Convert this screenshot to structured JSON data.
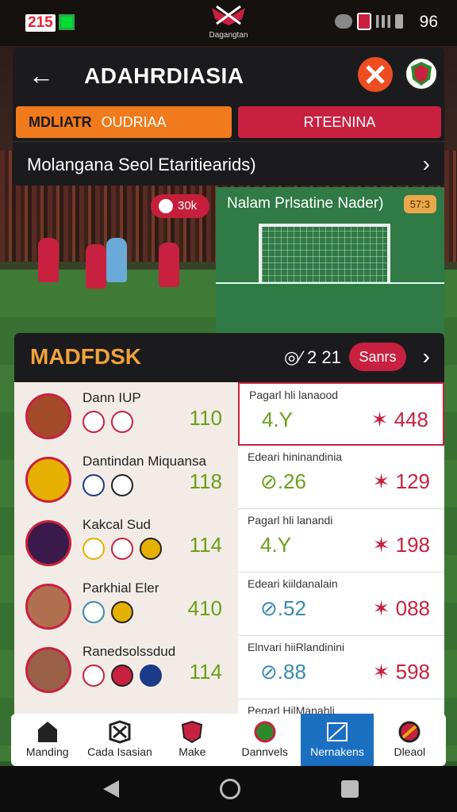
{
  "status_bar": {
    "left_badge": "215",
    "right_value": "96",
    "logo_text": "Dagangtan"
  },
  "header": {
    "title": "ADAHRDIASIA",
    "back_icon": "arrow-left-icon"
  },
  "tabs": [
    {
      "bold": "MDLIATR",
      "rest": "OUDRIAA"
    },
    {
      "label": "RTEENINA"
    }
  ],
  "subrow": {
    "text": "Molangana Seol Etaritiearids)"
  },
  "hero": {
    "pill": "30k",
    "goal_label": "Nalam Prlsatine Nader)",
    "goal_badge": "57:3"
  },
  "card": {
    "title": "MADFDSK",
    "count": "◎⁄ 2 21",
    "button": "Sanrs",
    "left_rows": [
      {
        "name": "Dann IUP",
        "value": "110"
      },
      {
        "name": "Dantindan Miquansa",
        "value": "118"
      },
      {
        "name": "Kakcal Sud",
        "value": "114"
      },
      {
        "name": "Parkhial Eler",
        "value": "410"
      },
      {
        "name": "Ranedsolssdud",
        "value": "114"
      }
    ],
    "right_rows": [
      {
        "label": "Pagarl hli lanaood",
        "value": "4.Y",
        "num": "✶ 448"
      },
      {
        "label": "Edeari hininandinia",
        "value": "⊘.26",
        "num": "✶ 129"
      },
      {
        "label": "Pagarl hli lanandi",
        "value": "4.Y",
        "num": "✶ 198"
      },
      {
        "label": "Edeari kiildanalain",
        "value": "⊘.52",
        "num": "✶ 088"
      },
      {
        "label": "Elnvari hiiRlandinini",
        "value": "⊘.88",
        "num": "✶ 598"
      },
      {
        "label": "Pegarl HilManahli",
        "value": "",
        "num": ""
      }
    ]
  },
  "bottom_nav": [
    {
      "label": "Manding",
      "icon": "home-icon"
    },
    {
      "label": "Cada Isasian",
      "icon": "logo-icon"
    },
    {
      "label": "Make",
      "icon": "shield-icon"
    },
    {
      "label": "Dannvels",
      "icon": "crest-icon"
    },
    {
      "label": "Nernakens",
      "icon": "map-icon"
    },
    {
      "label": "Dleaol",
      "icon": "ball-icon"
    }
  ],
  "colors": {
    "accent_red": "#c8213f",
    "accent_orange": "#f07a1c",
    "value_green": "#6aa01a",
    "nav_active": "#1b6fc1"
  }
}
